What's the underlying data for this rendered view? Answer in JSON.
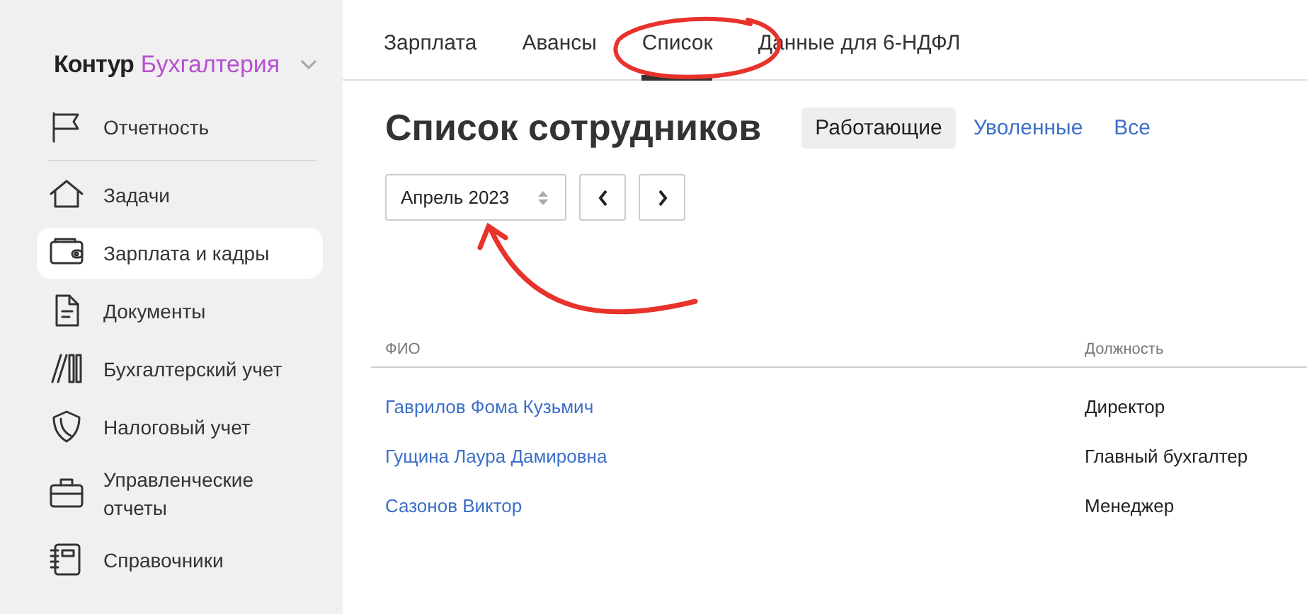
{
  "sidebar": {
    "logo": {
      "brand": "Контур",
      "product": "Бухгалтерия"
    },
    "sections": [
      [
        {
          "label": "Отчетность",
          "selected": false
        }
      ],
      [
        {
          "label": "Задачи",
          "selected": false
        },
        {
          "label": "Зарплата и кадры",
          "selected": true
        },
        {
          "label": "Документы",
          "selected": false
        },
        {
          "label": "Бухгалтерский учет",
          "selected": false
        },
        {
          "label": "Налоговый учет",
          "selected": false
        },
        {
          "label": "Управленческие отчеты",
          "selected": false
        },
        {
          "label": "Справочники",
          "selected": false
        }
      ]
    ]
  },
  "tabs": [
    {
      "label": "Зарплата",
      "selected": false
    },
    {
      "label": "Авансы",
      "selected": false
    },
    {
      "label": "Список",
      "selected": true
    },
    {
      "label": "Данные для 6-НДФЛ",
      "selected": false
    }
  ],
  "page_title": "Список сотрудников",
  "filters": [
    {
      "label": "Работающие",
      "selected": true
    },
    {
      "label": "Уволенные",
      "selected": false
    },
    {
      "label": "Все",
      "selected": false
    }
  ],
  "period": {
    "value": "Апрель 2023"
  },
  "table": {
    "columns": [
      "ФИО",
      "Должность"
    ],
    "rows": [
      [
        "Гаврилов Фома Кузьмич",
        "Директор"
      ],
      [
        "Гущина Лаура Дамировна",
        "Главный бухгалтер"
      ],
      [
        "Сазонов Виктор",
        "Менеджер"
      ]
    ]
  }
}
